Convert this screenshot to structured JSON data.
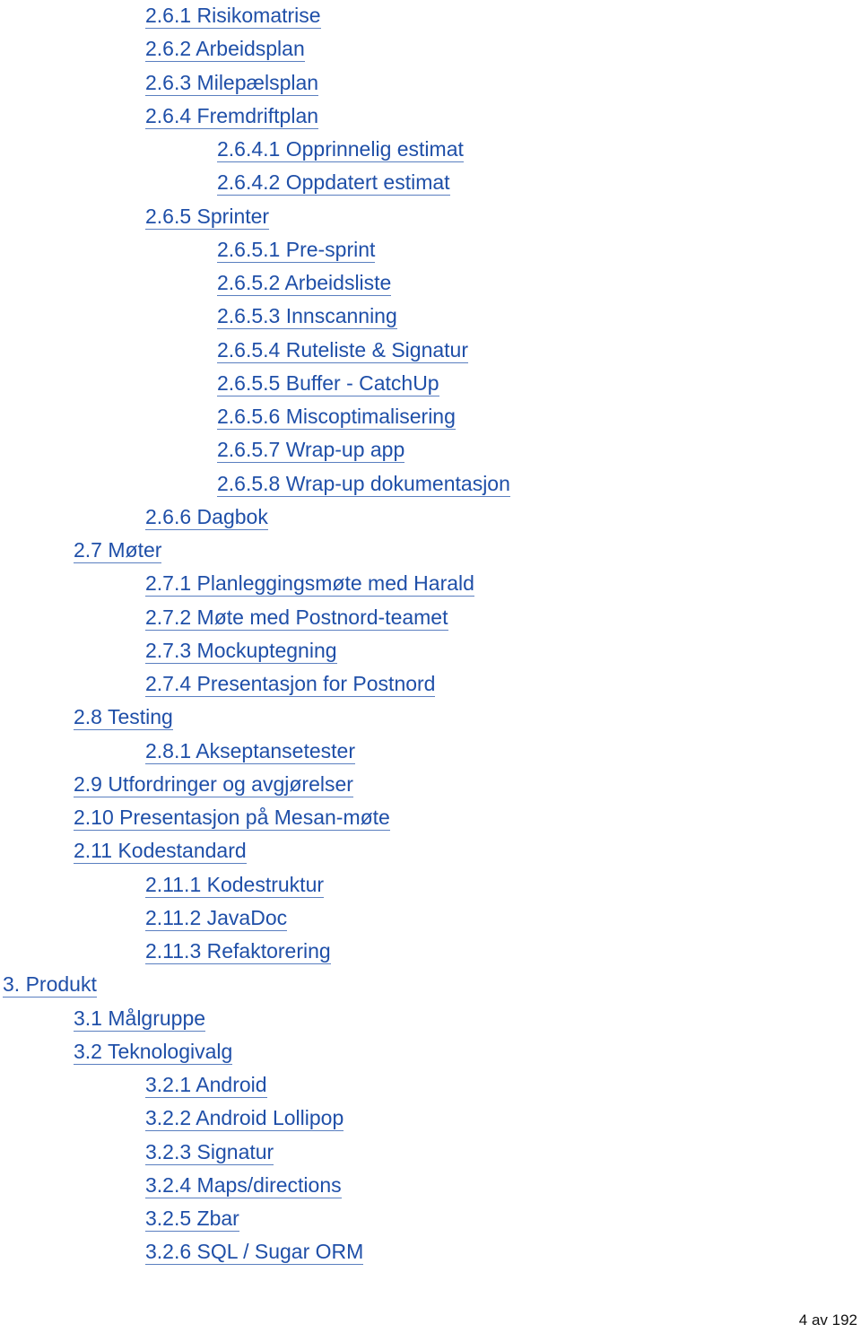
{
  "toc": [
    {
      "level": 2,
      "text": "2.6.1 Risikomatrise"
    },
    {
      "level": 2,
      "text": "2.6.2 Arbeidsplan"
    },
    {
      "level": 2,
      "text": "2.6.3 Milepælsplan"
    },
    {
      "level": 2,
      "text": "2.6.4 Fremdriftplan"
    },
    {
      "level": 3,
      "text": "2.6.4.1 Opprinnelig estimat"
    },
    {
      "level": 3,
      "text": "2.6.4.2 Oppdatert estimat"
    },
    {
      "level": 2,
      "text": "2.6.5 Sprinter"
    },
    {
      "level": 3,
      "text": "2.6.5.1 Pre-sprint"
    },
    {
      "level": 3,
      "text": "2.6.5.2 Arbeidsliste"
    },
    {
      "level": 3,
      "text": "2.6.5.3 Innscanning"
    },
    {
      "level": 3,
      "text": "2.6.5.4 Ruteliste & Signatur"
    },
    {
      "level": 3,
      "text": "2.6.5.5 Buffer - CatchUp"
    },
    {
      "level": 3,
      "text": "2.6.5.6 Miscoptimalisering"
    },
    {
      "level": 3,
      "text": "2.6.5.7 Wrap-up app"
    },
    {
      "level": 3,
      "text": "2.6.5.8 Wrap-up dokumentasjon"
    },
    {
      "level": 2,
      "text": "2.6.6 Dagbok"
    },
    {
      "level": 1,
      "text": "2.7 Møter"
    },
    {
      "level": 2,
      "text": "2.7.1 Planleggingsmøte med Harald"
    },
    {
      "level": 2,
      "text": "2.7.2 Møte med Postnord-teamet"
    },
    {
      "level": 2,
      "text": "2.7.3 Mockuptegning"
    },
    {
      "level": 2,
      "text": "2.7.4 Presentasjon for Postnord"
    },
    {
      "level": 1,
      "text": "2.8 Testing"
    },
    {
      "level": 2,
      "text": "2.8.1 Akseptansetester"
    },
    {
      "level": 1,
      "text": "2.9 Utfordringer og avgjørelser"
    },
    {
      "level": 1,
      "text": "2.10 Presentasjon på Mesan-møte"
    },
    {
      "level": 1,
      "text": "2.11 Kodestandard"
    },
    {
      "level": 2,
      "text": "2.11.1 Kodestruktur"
    },
    {
      "level": 2,
      "text": "2.11.2 JavaDoc"
    },
    {
      "level": 2,
      "text": "2.11.3 Refaktorering"
    },
    {
      "level": 0,
      "text": "3. Produkt"
    },
    {
      "level": 1,
      "text": "3.1 Målgruppe"
    },
    {
      "level": 1,
      "text": "3.2 Teknologivalg"
    },
    {
      "level": 2,
      "text": "3.2.1 Android"
    },
    {
      "level": 2,
      "text": "3.2.2 Android Lollipop"
    },
    {
      "level": 2,
      "text": "3.2.3 Signatur"
    },
    {
      "level": 2,
      "text": "3.2.4 Maps/directions"
    },
    {
      "level": 2,
      "text": "3.2.5 Zbar"
    },
    {
      "level": 2,
      "text": "3.2.6 SQL / Sugar ORM"
    }
  ],
  "footer": {
    "page_number": "4 av 192"
  },
  "colors": {
    "link": "#1f4fa8"
  }
}
